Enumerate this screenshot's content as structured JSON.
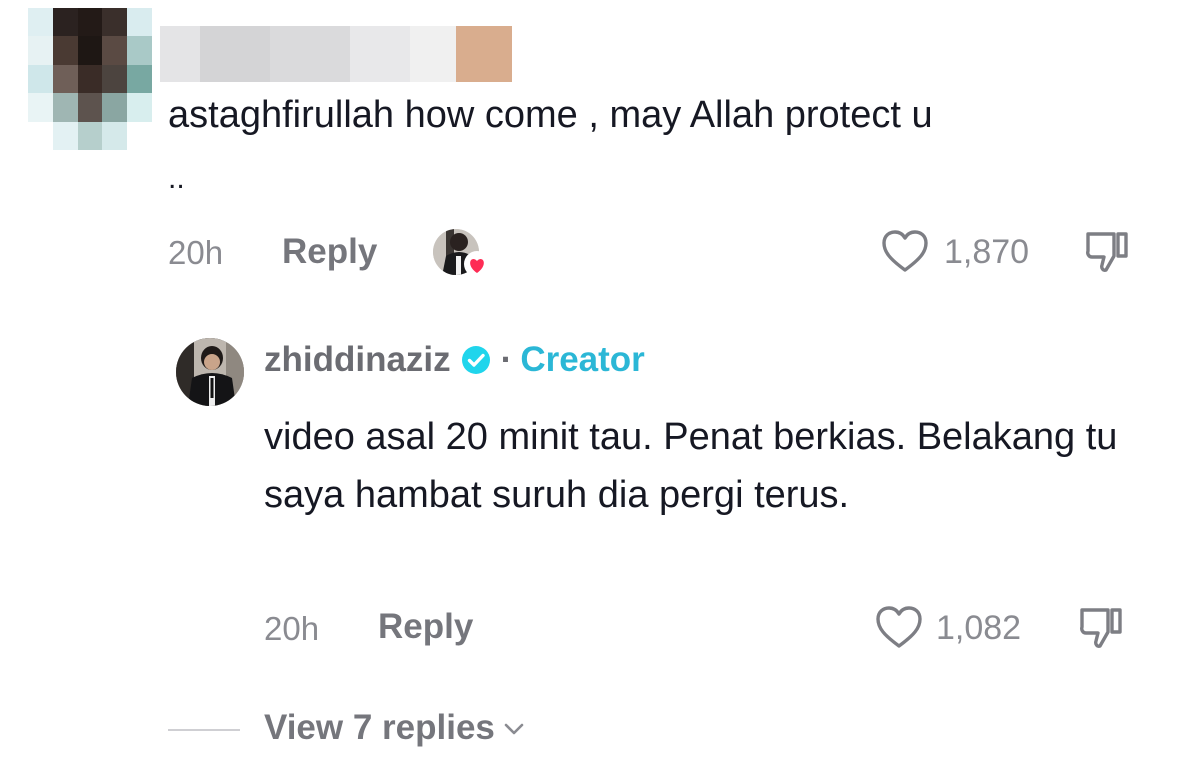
{
  "comment": {
    "text": "astaghfirullah how come , may Allah protect u",
    "continuation": "..",
    "time": "20h",
    "reply_label": "Reply",
    "like_count": "1,870"
  },
  "creator_reply": {
    "username": "zhiddinaziz",
    "separator": "·",
    "role_tag": "Creator",
    "text": "video asal 20 minit tau. Penat berkias. Belakang tu saya hambat suruh dia pergi terus.",
    "time": "20h",
    "reply_label": "Reply",
    "like_count": "1,082"
  },
  "view_replies": {
    "label": "View 7 replies"
  },
  "icons": {
    "like": "heart-outline-icon",
    "dislike": "thumbs-down-icon",
    "verified": "verified-badge-icon",
    "creator_liked": "creator-liked-avatar-heart-icon",
    "expand": "chevron-down-icon"
  },
  "colors": {
    "text": "#161823",
    "muted": "#8a8b91",
    "creator_tag": "#2bb7d6",
    "verified": "#20d5ec",
    "like_heart": "#fe2c55"
  }
}
